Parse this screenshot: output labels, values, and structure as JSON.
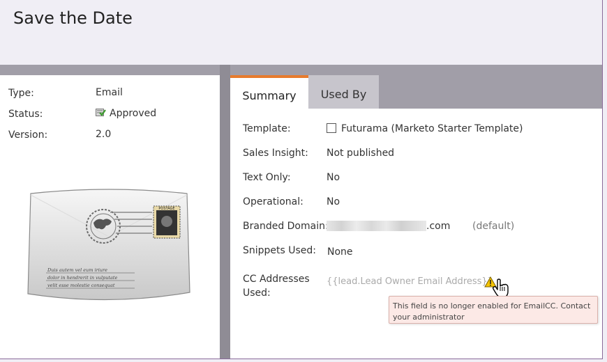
{
  "page": {
    "title": "Save the Date"
  },
  "info": {
    "type_label": "Type:",
    "type_value": "Email",
    "status_label": "Status:",
    "status_value": "Approved",
    "version_label": "Version:",
    "version_value": "2.0"
  },
  "thumbnail": {
    "stamp_text_top": "POSTAGE",
    "script_lines": [
      "Duis autem vel eum iriure",
      "dolor in hendrerit in vulputate",
      "velit esse molestie consequat"
    ]
  },
  "tabs": [
    {
      "label": "Summary",
      "active": true
    },
    {
      "label": "Used By",
      "active": false
    }
  ],
  "summary": {
    "template_label": "Template:",
    "template_value": "Futurama (Marketo Starter Template)",
    "sales_insight_label": "Sales Insight:",
    "sales_insight_value": "Not published",
    "text_only_label": "Text Only:",
    "text_only_value": "No",
    "operational_label": "Operational:",
    "operational_value": "No",
    "branded_domain_label": "Branded Domain:",
    "branded_domain_suffix": ".com",
    "branded_domain_note": "(default)",
    "snippets_label": "Snippets Used:",
    "snippets_value": "None",
    "cc_label_line1": "CC Addresses",
    "cc_label_line2": "Used:",
    "cc_value": "{{lead.Lead Owner Email Address}}"
  },
  "tooltip": {
    "text": "This field is no longer enabled for EmailCC. Contact your administrator"
  },
  "colors": {
    "tab_accent": "#e77b2d",
    "tooltip_bg": "#fce9e6",
    "warning": "#f5c400"
  },
  "icons": [
    "approved-icon",
    "template-checkbox-icon",
    "warning-icon",
    "hand-cursor-icon"
  ]
}
